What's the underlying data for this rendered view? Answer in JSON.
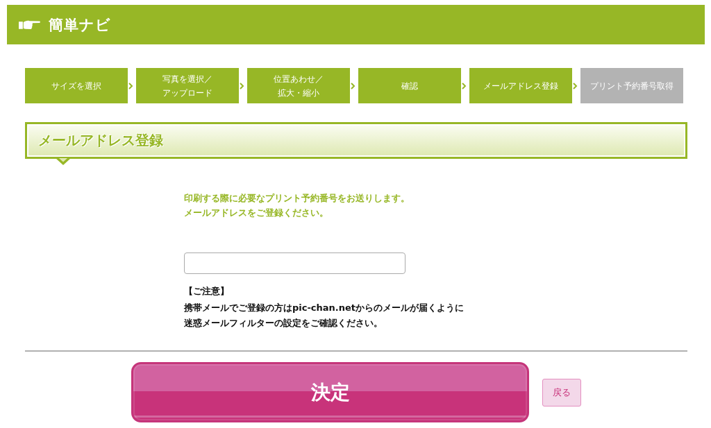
{
  "header": {
    "title": "簡単ナビ"
  },
  "steps": [
    {
      "lines": [
        "サイズを選択"
      ],
      "disabled": false
    },
    {
      "lines": [
        "写真を選択／",
        "アップロード"
      ],
      "disabled": false
    },
    {
      "lines": [
        "位置あわせ／",
        "拡大・縮小"
      ],
      "disabled": false
    },
    {
      "lines": [
        "確認"
      ],
      "disabled": false
    },
    {
      "lines": [
        "メールアドレス登録"
      ],
      "disabled": false
    },
    {
      "lines": [
        "プリント予約番号取得"
      ],
      "disabled": true
    }
  ],
  "section": {
    "heading": "メールアドレス登録"
  },
  "intro": {
    "lines": [
      "印刷する際に必要なプリント予約番号をお送りします。",
      "メールアドレスをご登録ください。"
    ]
  },
  "notice": {
    "title": "【ご注意】",
    "lines": [
      "携帯メールでご登録の方はpic-chan.netからのメールが届くように",
      "迷惑メールフィルターの設定をご確認ください。"
    ]
  },
  "actions": [
    {
      "kind": "primary",
      "label": "決定"
    },
    {
      "kind": "secondary",
      "label": "戻る"
    }
  ]
}
